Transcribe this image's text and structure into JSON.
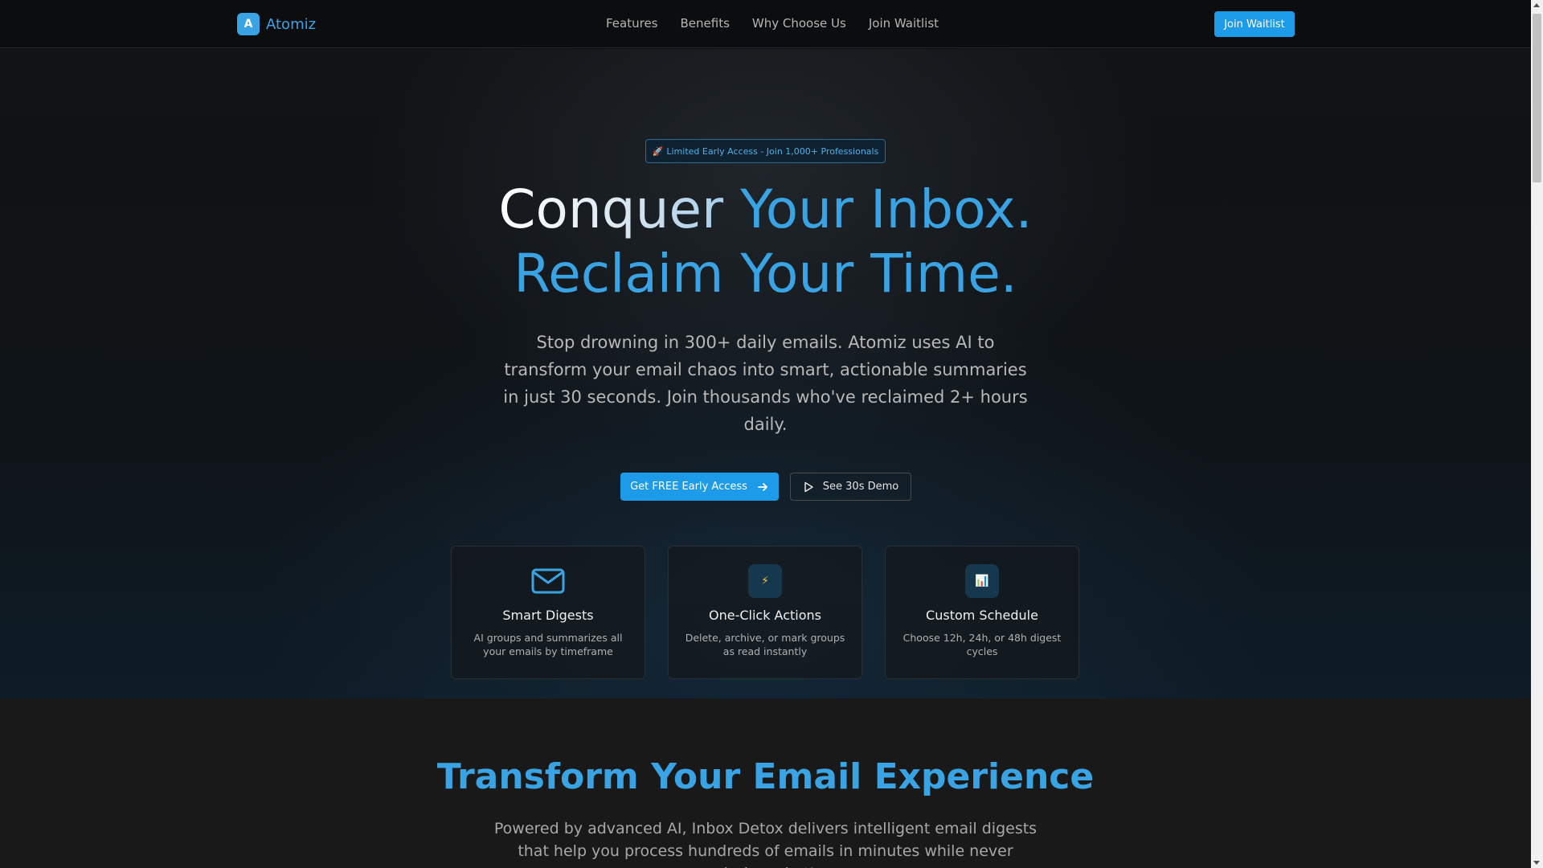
{
  "nav": {
    "logo_letter": "A",
    "logo_text": "Atomiz",
    "links": [
      "Features",
      "Benefits",
      "Why Choose Us",
      "Join Waitlist"
    ],
    "cta": "Join Waitlist"
  },
  "hero": {
    "badge_icon": "🚀",
    "badge_text": "Limited Early Access - Join 1,000+ Professionals",
    "headline_part1": "Conquer ",
    "headline_part2": "Your Inbox.",
    "headline_line2": "Reclaim Your Time.",
    "subtitle": "Stop drowning in 300+ daily emails. Atomiz uses AI to transform your email chaos into smart, actionable summaries in just 30 seconds. Join thousands who've reclaimed 2+ hours daily.",
    "primary_cta": "Get FREE Early Access",
    "secondary_cta": "See 30s Demo"
  },
  "features": [
    {
      "icon": "mail-icon",
      "title": "Smart Digests",
      "description": "AI groups and summarizes all your emails by timeframe"
    },
    {
      "icon": "lightning-icon",
      "glyph": "⚡",
      "title": "One-Click Actions",
      "description": "Delete, archive, or mark groups as read instantly"
    },
    {
      "icon": "bar-chart-icon",
      "glyph": "📊",
      "title": "Custom Schedule",
      "description": "Choose 12h, 24h, or 48h digest cycles"
    }
  ],
  "section2": {
    "title": "Transform Your Email Experience",
    "text": "Powered by advanced AI, Inbox Detox delivers intelligent email digests that help you process hundreds of emails in minutes while never missing what's"
  },
  "colors": {
    "accent": "#3aa3e3",
    "button": "#1e9be8",
    "background": "#0f0f0f"
  }
}
